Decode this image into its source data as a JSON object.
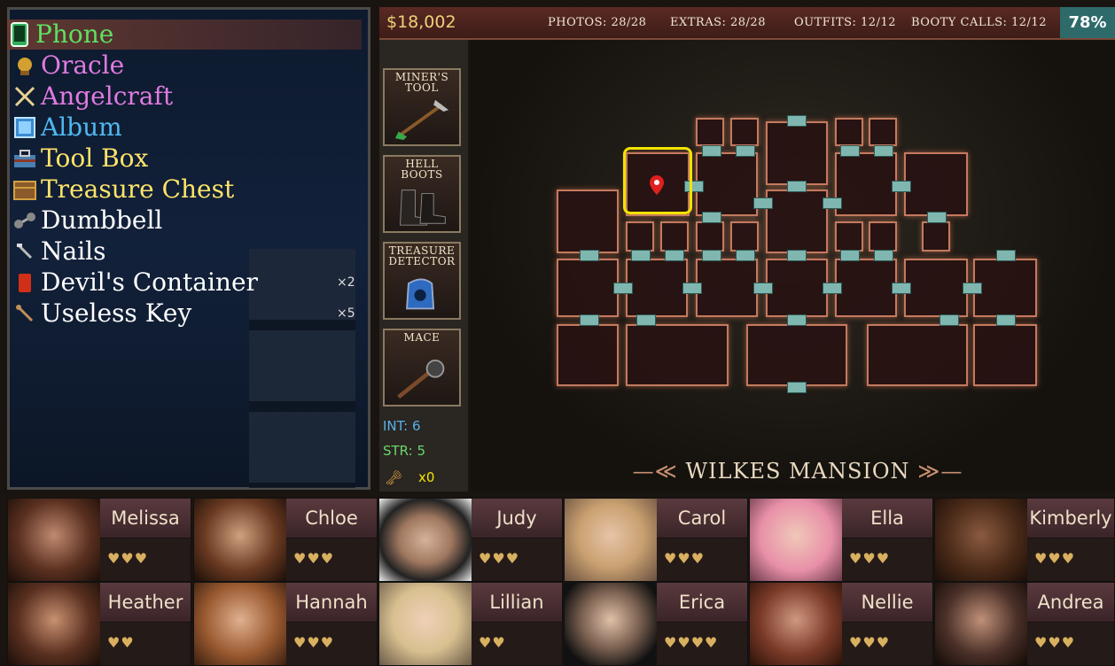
{
  "inventory": {
    "items": [
      {
        "label": "Phone",
        "color": "#5fe05f",
        "icon": "📱"
      },
      {
        "label": "Oracle",
        "color": "#e07be0",
        "icon": "🔮"
      },
      {
        "label": "Angelcraft",
        "color": "#e07be0",
        "icon": "⛏"
      },
      {
        "label": "Album",
        "color": "#4fb8f0",
        "icon": "🖼"
      },
      {
        "label": "Tool Box",
        "color": "#ffe46a",
        "icon": "🧰"
      },
      {
        "label": "Treasure Chest",
        "color": "#ffe46a",
        "icon": "🧳"
      },
      {
        "label": "Dumbbell",
        "color": "#ffffff",
        "icon": "🏋"
      },
      {
        "label": "Nails",
        "color": "#ffffff",
        "icon": "🔧"
      },
      {
        "label": "Devil's Container",
        "color": "#ffffff",
        "icon": "🧪"
      },
      {
        "label": "Useless Key",
        "color": "#ffffff",
        "icon": "🗝"
      }
    ],
    "qty_devils": "×2",
    "qty_key": "×5"
  },
  "topbar": {
    "money": "$18,002",
    "photos": "PHOTOS: 28/28",
    "extras": "EXTRAS: 28/28",
    "outfits": "OUTFITS: 12/12",
    "booty": "BOOTY CALLS: 12/12",
    "percent": "78%"
  },
  "tools": [
    {
      "name": "Miner's Tool",
      "icon": "shovel-icon"
    },
    {
      "name": "Hell Boots",
      "icon": "boots-icon"
    },
    {
      "name": "Treasure Detector",
      "icon": "detector-icon"
    },
    {
      "name": "Mace",
      "icon": "mace-icon"
    }
  ],
  "stats": {
    "int": "INT: 6",
    "str": "STR: 5",
    "keys": "x0"
  },
  "map": {
    "name": "WILKES MANSION"
  },
  "characters": [
    {
      "name": "Melissa",
      "hearts": "♥♥♥"
    },
    {
      "name": "Chloe",
      "hearts": "♥♥♥"
    },
    {
      "name": "Judy",
      "hearts": "♥♥♥"
    },
    {
      "name": "Carol",
      "hearts": "♥♥♥"
    },
    {
      "name": "Ella",
      "hearts": "♥♥♥"
    },
    {
      "name": "Kimberly",
      "hearts": "♥♥♥"
    },
    {
      "name": "Heather",
      "hearts": "♥♥"
    },
    {
      "name": "Hannah",
      "hearts": "♥♥♥"
    },
    {
      "name": "Lillian",
      "hearts": "♥♥"
    },
    {
      "name": "Erica",
      "hearts": "♥♥♥♥"
    },
    {
      "name": "Nellie",
      "hearts": "♥♥♥"
    },
    {
      "name": "Andrea",
      "hearts": "♥♥♥"
    }
  ]
}
